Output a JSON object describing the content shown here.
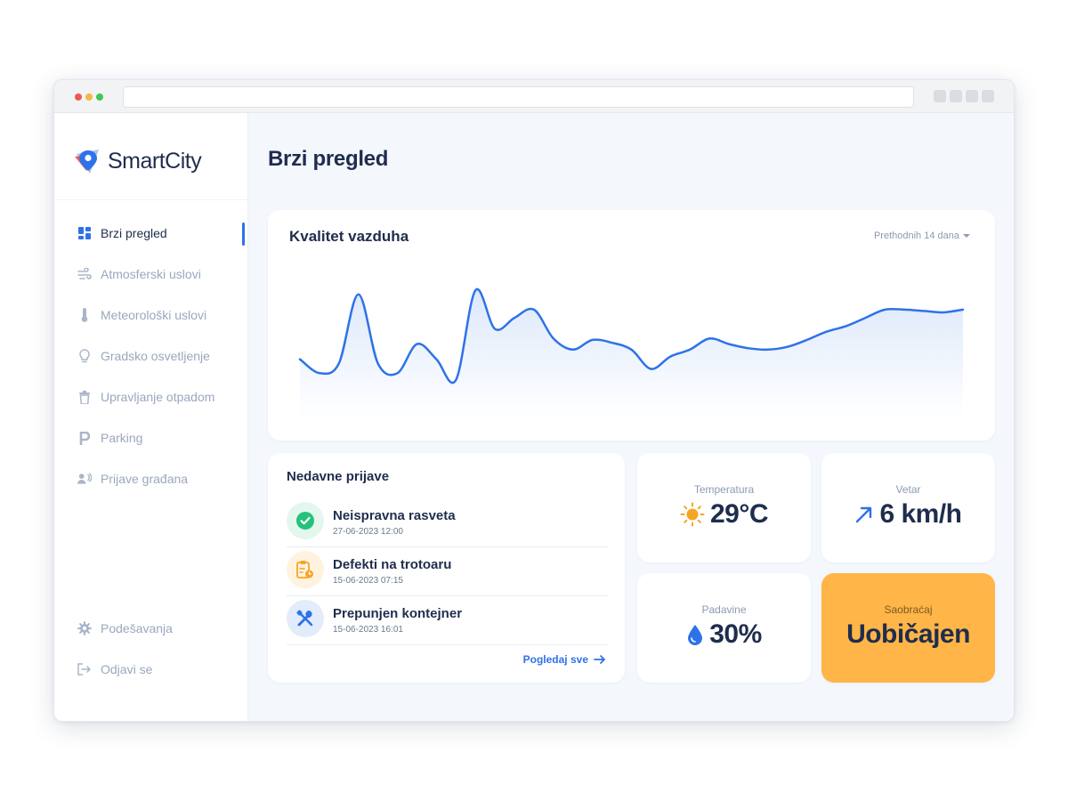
{
  "app": {
    "name": "SmartCity"
  },
  "sidebar": {
    "items": [
      {
        "label": "Brzi pregled",
        "icon": "dashboard-grid-icon",
        "active": true
      },
      {
        "label": "Atmosferski uslovi",
        "icon": "wind-icon"
      },
      {
        "label": "Meteorološki uslovi",
        "icon": "thermometer-icon"
      },
      {
        "label": "Gradsko osvetljenje",
        "icon": "lightbulb-icon"
      },
      {
        "label": "Upravljanje otpadom",
        "icon": "trash-icon"
      },
      {
        "label": "Parking",
        "icon": "parking-icon"
      },
      {
        "label": "Prijave građana",
        "icon": "citizen-report-icon"
      }
    ],
    "bottom_items": [
      {
        "label": "Podešavanja",
        "icon": "gear-icon"
      },
      {
        "label": "Odjavi se",
        "icon": "logout-icon"
      }
    ]
  },
  "page": {
    "title": "Brzi pregled"
  },
  "air_quality": {
    "title": "Kvalitet vazduha",
    "period_label": "Prethodnih 14 dana"
  },
  "chart_data": {
    "type": "area",
    "title": "Kvalitet vazduha",
    "series": [
      {
        "values": [
          0.37,
          0.27,
          0.34,
          0.84,
          0.34,
          0.27,
          0.48,
          0.37,
          0.22,
          0.87,
          0.59,
          0.67,
          0.73,
          0.52,
          0.44,
          0.51,
          0.49,
          0.44,
          0.3,
          0.39,
          0.44,
          0.52,
          0.48,
          0.45,
          0.44,
          0.46,
          0.51,
          0.57,
          0.61,
          0.67,
          0.73,
          0.73,
          0.72,
          0.71,
          0.73
        ]
      }
    ],
    "colors": {
      "line": "#2e72e8",
      "fill_top": "#dce8fb",
      "fill_bottom": "#ffffff"
    },
    "grid": false,
    "legend": "none"
  },
  "reports": {
    "title": "Nedavne prijave",
    "items": [
      {
        "title": "Neispravna rasveta",
        "date": "27-06-2023 12:00",
        "icon": "check-circle-icon",
        "status_color": "#25c27a"
      },
      {
        "title": "Defekti na trotoaru",
        "date": "15-06-2023 07:15",
        "icon": "clipboard-clock-icon",
        "status_color": "#f5a524"
      },
      {
        "title": "Prepunjen kontejner",
        "date": "15-06-2023 16:01",
        "icon": "tools-icon",
        "status_color": "#2e72e8"
      }
    ],
    "see_all": "Pogledaj sve"
  },
  "stats": {
    "temperature": {
      "label": "Temperatura",
      "value": "29°C",
      "icon": "sun-icon"
    },
    "wind": {
      "label": "Vetar",
      "value": "6 km/h",
      "icon": "arrow-up-right-icon"
    },
    "rain": {
      "label": "Padavine",
      "value": "30%",
      "icon": "water-drop-icon"
    },
    "traffic": {
      "label": "Saobraćaj",
      "value": "Uobičajen",
      "color": "#ffb547"
    }
  },
  "colors": {
    "accent": "#2e72e8",
    "text_primary": "#1f2d4d",
    "text_muted": "#9aa7bd",
    "main_bg": "#f4f7fc"
  }
}
